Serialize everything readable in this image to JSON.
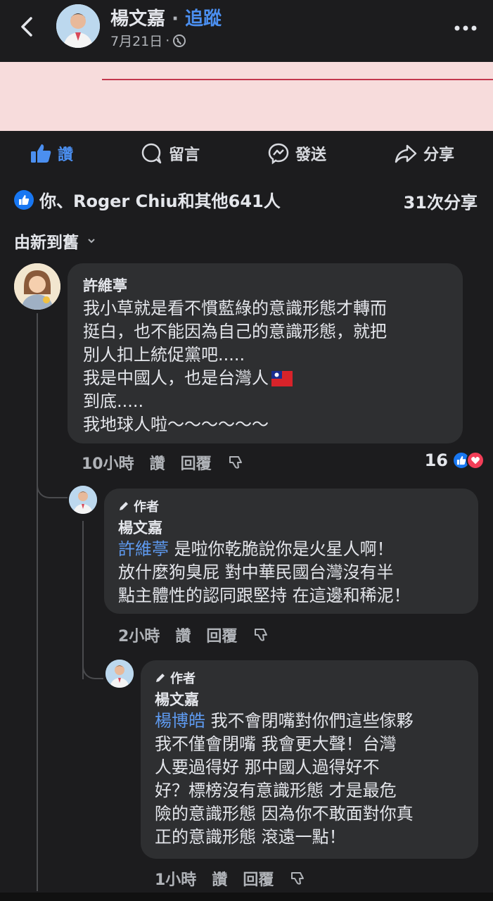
{
  "header": {
    "author_name": "楊文嘉",
    "separator": "·",
    "follow_label": "追蹤",
    "date": "7月21日",
    "date_separator": "·",
    "icons": [
      "back-chevron-icon",
      "globe-icon",
      "more-icon"
    ]
  },
  "actions": {
    "like_label": "讚",
    "comment_label": "留言",
    "send_label": "發送",
    "share_label": "分享"
  },
  "reactions": {
    "summary": "你、Roger Chiu和其他641人",
    "shares": "31次分享"
  },
  "sort": {
    "label": "由新到舊"
  },
  "comments": [
    {
      "name": "許維葶",
      "lines": [
        "我小草就是看不慣藍綠的意識形態才轉而",
        "挺白，也不能因為自己的意識形態，就把",
        "別人扣上統促黨吧.....",
        "我是中國人，也是台灣人",
        "到底.....",
        "我地球人啦～～～～～～"
      ],
      "time": "10小時",
      "like_label": "讚",
      "reply_label": "回覆",
      "reaction_count": "16"
    },
    {
      "author_tag": "作者",
      "name": "楊文嘉",
      "mention": "許維葶",
      "lines": [
        " 是啦你乾脆說你是火星人啊！",
        "放什麼狗臭屁 對中華民國台灣沒有半",
        "點主體性的認同跟堅持 在這邊和稀泥！"
      ],
      "time": "2小時",
      "like_label": "讚",
      "reply_label": "回覆"
    },
    {
      "author_tag": "作者",
      "name": "楊文嘉",
      "mention": "楊博皓",
      "lines": [
        " 我不會閉嘴對你們這些傢夥",
        "我不僅會閉嘴 我會更大聲！台灣",
        "人要過得好 那中國人過得好不",
        "好？標榜沒有意識形態 才是最危",
        "險的意識形態 因為你不敢面對你真",
        "正的意識形態 滾遠一點！"
      ],
      "time": "1小時",
      "like_label": "讚",
      "reply_label": "回覆"
    }
  ],
  "colors": {
    "background": "#1c1c1e",
    "bubble": "#2e2f31",
    "accent": "#4b8ff0",
    "banner": "#f7dcdc",
    "heart": "#f33e58"
  }
}
